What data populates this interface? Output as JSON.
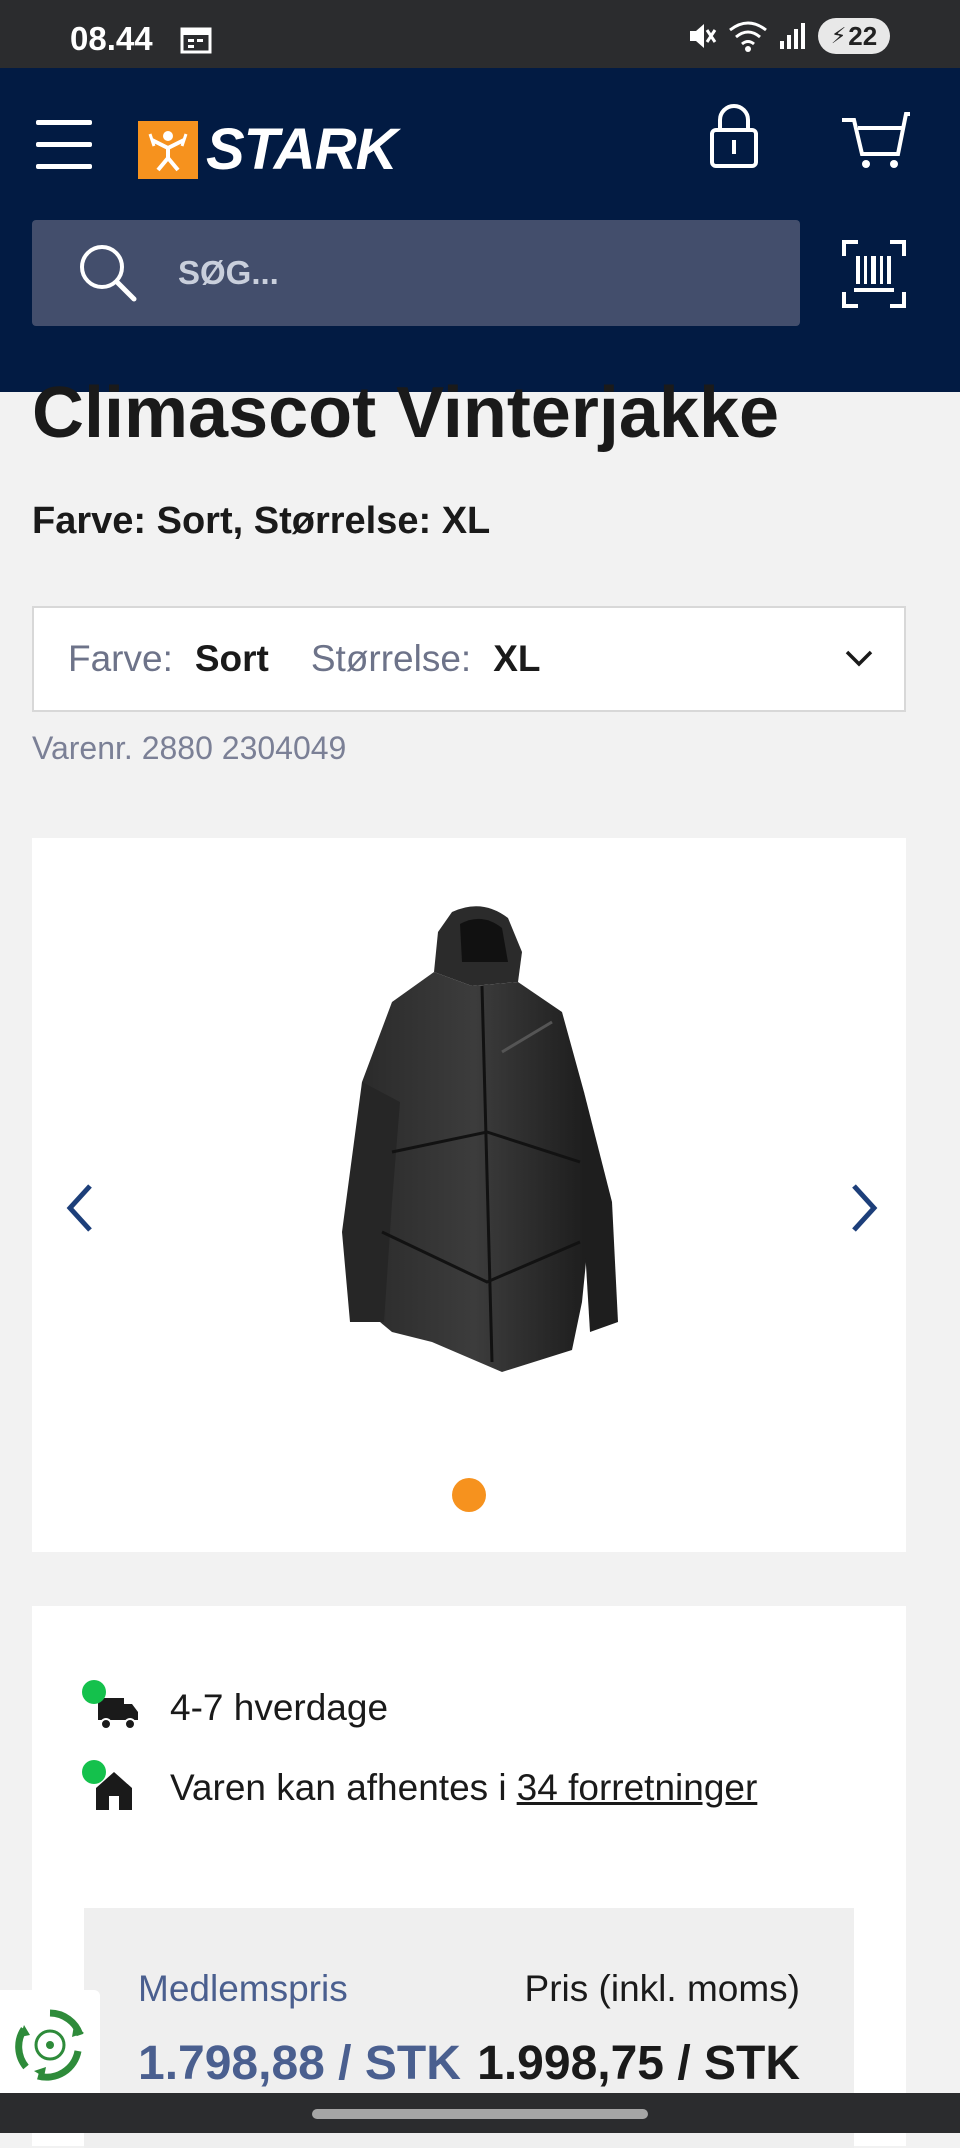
{
  "status_bar": {
    "time": "08.44",
    "battery": "22",
    "icons": [
      "calendar-icon",
      "mute-icon",
      "wifi-icon",
      "signal-icon",
      "battery-icon"
    ]
  },
  "header": {
    "brand": "STARK",
    "search_placeholder": "SØG...",
    "icons": [
      "menu-icon",
      "lock-icon",
      "cart-icon",
      "search-icon",
      "barcode-scan-icon"
    ],
    "background_color": "#021b43",
    "accent_color": "#f6921e"
  },
  "product": {
    "title": "Climascot Vinterjakke",
    "subtitle": "Farve: Sort, Størrelse: XL",
    "variant": {
      "color_label": "Farve:",
      "color_value": "Sort",
      "size_label": "Størrelse:",
      "size_value": "XL"
    },
    "item_number": "Varenr. 2880 2304049",
    "gallery": {
      "image_count": 1,
      "active_index": 0
    }
  },
  "availability": {
    "delivery_text": "4-7 hverdage",
    "pickup_text": "Varen kan afhentes i",
    "pickup_link": "34 forretninger",
    "status_color": "#14c14c"
  },
  "pricing": {
    "member_label": "Medlemspris",
    "member_price": "1.798,88 / STK",
    "regular_label": "Pris (inkl. moms)",
    "regular_price": "1.998,75 / STK"
  }
}
